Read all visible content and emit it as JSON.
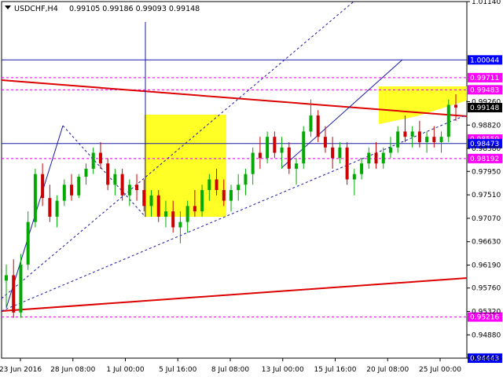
{
  "header": {
    "symbol": "USDCHF,H4",
    "ohlc": "0.99105 0.99186 0.99093 0.99148"
  },
  "colors": {
    "bull": "#00aa00",
    "bear": "#cc0000",
    "trend_red": "#dd0000",
    "channel_blue": "#1a1aa8",
    "level_magenta": "#dd00dd",
    "zone_yellow": "#ffff00",
    "label_blue": "#0000ff",
    "label_magenta": "#ff00ff",
    "label_black": "#000000"
  },
  "chart_data": {
    "type": "candlestick",
    "symbol": "USDCHF",
    "timeframe": "H4",
    "ylim": [
      0.94443,
      1.0114
    ],
    "y_ticks": [
      "1.01140",
      "0.99260",
      "0.98820",
      "0.98380",
      "0.97950",
      "0.97510",
      "0.97070",
      "0.96630",
      "0.96190",
      "0.95760",
      "0.95320",
      "0.94880",
      "0.94443"
    ],
    "x_ticks": [
      "23 Jun 2016",
      "28 Jun 08:00",
      "1 Jul 00:00",
      "5 Jul 16:00",
      "8 Jul 08:00",
      "13 Jul 00:00",
      "15 Jul 16:00",
      "20 Jul 08:00",
      "25 Jul 00:00"
    ],
    "price_labels": [
      {
        "text": "1.00044",
        "value": 1.00044,
        "color": "blue"
      },
      {
        "text": "0.99711",
        "value": 0.99711,
        "color": "magenta"
      },
      {
        "text": "0.99483",
        "value": 0.99483,
        "color": "magenta"
      },
      {
        "text": "0.99148",
        "value": 0.99148,
        "color": "black"
      },
      {
        "text": "0.98559",
        "value": 0.98559,
        "color": "magenta"
      },
      {
        "text": "0.98473",
        "value": 0.98473,
        "color": "blue"
      },
      {
        "text": "0.98192",
        "value": 0.98192,
        "color": "magenta"
      },
      {
        "text": "0.95216",
        "value": 0.95216,
        "color": "magenta"
      },
      {
        "text": "0.94443",
        "value": 0.94443,
        "color": "blue"
      }
    ],
    "candles": [
      [
        0.959,
        0.962,
        0.954,
        0.96
      ],
      [
        0.96,
        0.963,
        0.952,
        0.953
      ],
      [
        0.953,
        0.964,
        0.952,
        0.962
      ],
      [
        0.962,
        0.972,
        0.961,
        0.97
      ],
      [
        0.97,
        0.98,
        0.969,
        0.979
      ],
      [
        0.979,
        0.981,
        0.973,
        0.9745
      ],
      [
        0.9745,
        0.977,
        0.97,
        0.971
      ],
      [
        0.971,
        0.975,
        0.969,
        0.974
      ],
      [
        0.974,
        0.978,
        0.973,
        0.977
      ],
      [
        0.977,
        0.979,
        0.974,
        0.975
      ],
      [
        0.975,
        0.979,
        0.9745,
        0.9785
      ],
      [
        0.9785,
        0.981,
        0.977,
        0.98
      ],
      [
        0.98,
        0.984,
        0.979,
        0.983
      ],
      [
        0.983,
        0.985,
        0.98,
        0.981
      ],
      [
        0.981,
        0.982,
        0.976,
        0.977
      ],
      [
        0.977,
        0.98,
        0.975,
        0.979
      ],
      [
        0.979,
        0.98,
        0.974,
        0.975
      ],
      [
        0.975,
        0.978,
        0.973,
        0.977
      ],
      [
        0.977,
        0.979,
        0.974,
        0.976
      ],
      [
        0.976,
        0.978,
        0.972,
        0.973
      ],
      [
        0.973,
        0.976,
        0.971,
        0.975
      ],
      [
        0.975,
        0.976,
        0.97,
        0.971
      ],
      [
        0.971,
        0.974,
        0.969,
        0.972
      ],
      [
        0.972,
        0.974,
        0.968,
        0.969
      ],
      [
        0.969,
        0.972,
        0.966,
        0.97
      ],
      [
        0.97,
        0.974,
        0.968,
        0.973
      ],
      [
        0.973,
        0.976,
        0.971,
        0.972
      ],
      [
        0.972,
        0.977,
        0.971,
        0.976
      ],
      [
        0.976,
        0.979,
        0.974,
        0.978
      ],
      [
        0.978,
        0.98,
        0.975,
        0.976
      ],
      [
        0.976,
        0.978,
        0.973,
        0.974
      ],
      [
        0.974,
        0.977,
        0.972,
        0.976
      ],
      [
        0.976,
        0.979,
        0.974,
        0.977
      ],
      [
        0.977,
        0.98,
        0.975,
        0.979
      ],
      [
        0.979,
        0.984,
        0.977,
        0.983
      ],
      [
        0.983,
        0.986,
        0.98,
        0.982
      ],
      [
        0.982,
        0.987,
        0.981,
        0.986
      ],
      [
        0.986,
        0.987,
        0.982,
        0.983
      ],
      [
        0.983,
        0.986,
        0.98,
        0.984
      ],
      [
        0.984,
        0.985,
        0.979,
        0.98
      ],
      [
        0.98,
        0.982,
        0.977,
        0.981
      ],
      [
        0.981,
        0.988,
        0.98,
        0.987
      ],
      [
        0.987,
        0.993,
        0.986,
        0.99
      ],
      [
        0.99,
        0.991,
        0.985,
        0.986
      ],
      [
        0.986,
        0.988,
        0.983,
        0.984
      ],
      [
        0.984,
        0.986,
        0.98,
        0.982
      ],
      [
        0.982,
        0.985,
        0.981,
        0.984
      ],
      [
        0.984,
        0.985,
        0.977,
        0.978
      ],
      [
        0.978,
        0.98,
        0.975,
        0.979
      ],
      [
        0.979,
        0.982,
        0.978,
        0.981
      ],
      [
        0.981,
        0.984,
        0.98,
        0.983
      ],
      [
        0.983,
        0.985,
        0.98,
        0.981
      ],
      [
        0.981,
        0.984,
        0.98,
        0.983
      ],
      [
        0.983,
        0.986,
        0.982,
        0.984
      ],
      [
        0.984,
        0.988,
        0.983,
        0.987
      ],
      [
        0.987,
        0.99,
        0.985,
        0.986
      ],
      [
        0.986,
        0.988,
        0.984,
        0.987
      ],
      [
        0.987,
        0.989,
        0.984,
        0.985
      ],
      [
        0.985,
        0.987,
        0.983,
        0.986
      ],
      [
        0.986,
        0.988,
        0.984,
        0.985
      ],
      [
        0.985,
        0.987,
        0.983,
        0.986
      ],
      [
        0.986,
        0.993,
        0.985,
        0.992
      ],
      [
        0.992,
        0.994,
        0.989,
        0.9915
      ]
    ]
  }
}
